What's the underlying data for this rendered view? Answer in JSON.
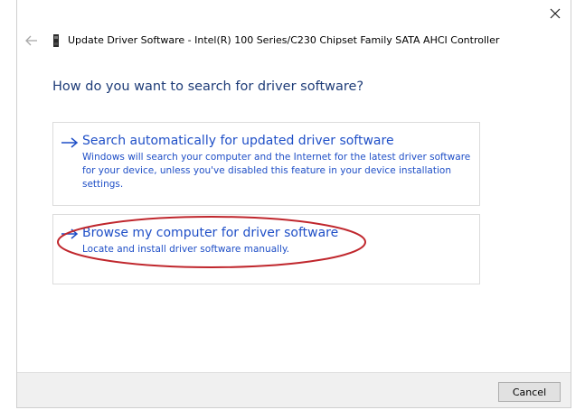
{
  "window": {
    "title": "Update Driver Software - Intel(R) 100 Series/C230 Chipset Family SATA AHCI Controller",
    "close_icon": "close-icon",
    "back_icon": "back-arrow-icon",
    "device_icon": "device-icon"
  },
  "main": {
    "heading": "How do you want to search for driver software?",
    "options": [
      {
        "title": "Search automatically for updated driver software",
        "description": "Windows will search your computer and the Internet for the latest driver software for your device, unless you've disabled this feature in your device installation settings.",
        "icon": "arrow-right-icon"
      },
      {
        "title": "Browse my computer for driver software",
        "description": "Locate and install driver software manually.",
        "icon": "arrow-right-icon"
      }
    ],
    "annotation_color": "#c0272d"
  },
  "footer": {
    "cancel_label": "Cancel"
  },
  "colors": {
    "heading": "#1e3c78",
    "link": "#1f4fc7",
    "footer_bg": "#f0f0f0"
  }
}
